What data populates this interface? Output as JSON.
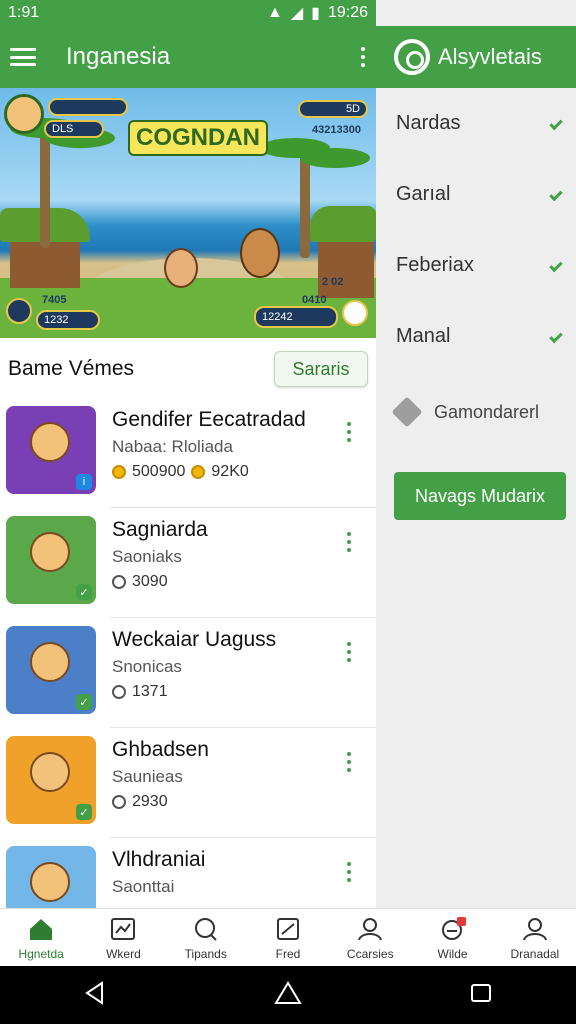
{
  "status": {
    "time": "1:91",
    "right_text": "19:26"
  },
  "appbar": {
    "title": "Inganesia"
  },
  "banner": {
    "game_title": "COGNDAN",
    "hud_top_left": "DLS",
    "hud_top_right_a": "5D",
    "hud_top_right_b": "43213300",
    "hud_bottom_left_a": "7405",
    "hud_bottom_left_b": "1232",
    "hud_bottom_right_a": "2 02",
    "hud_bottom_right_b": "0410",
    "hud_bottom_right_c": "12242"
  },
  "section": {
    "title": "Bame Vémes",
    "button": "Sararis"
  },
  "games": [
    {
      "title": "Gendifer Eecatradad",
      "subtitle": "Nabaa: Rloliada",
      "coins": "500900",
      "coins2": "92K0",
      "thumb_color": "#7b3fb5"
    },
    {
      "title": "Sagniarda",
      "subtitle": "Saoniaks",
      "count": "3090",
      "thumb_color": "#5aa84a"
    },
    {
      "title": "Weckaiar Uaguss",
      "subtitle": "Snonicas",
      "count": "1371",
      "thumb_color": "#4b7fc7"
    },
    {
      "title": "Ghbadsen",
      "subtitle": "Saunieas",
      "count": "2930",
      "thumb_color": "#f0a12a"
    },
    {
      "title": "Vlhdraniai",
      "subtitle": "Saonttai",
      "count": "",
      "thumb_color": "#72b7e8"
    }
  ],
  "drawer": {
    "title": "Alsyvletais",
    "items": [
      "Nardas",
      "Garıal",
      "Feberiax",
      "Manal"
    ],
    "extra": "Gamondarerl",
    "button": "Navags Mudarix"
  },
  "bottom_nav": [
    {
      "label": "Hgnetda",
      "icon": "home-icon"
    },
    {
      "label": "Wkerd",
      "icon": "chart-icon"
    },
    {
      "label": "Tipands",
      "icon": "search-icon"
    },
    {
      "label": "Fred",
      "icon": "edit-icon"
    },
    {
      "label": "Ccarsies",
      "icon": "person-icon"
    },
    {
      "label": "Wilde",
      "icon": "notification-icon"
    },
    {
      "label": "Dranadal",
      "icon": "profile-icon"
    }
  ],
  "colors": {
    "primary": "#43a047",
    "drawer_bg": "#eeeeee"
  }
}
